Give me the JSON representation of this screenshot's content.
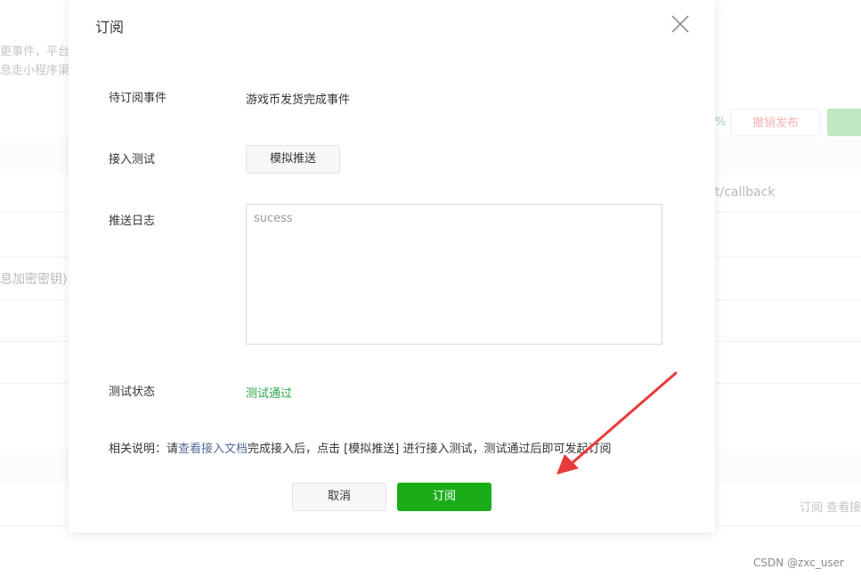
{
  "background": {
    "text_left_1": "更事件，平台",
    "text_left_2": "息走小程序渠",
    "percent": "%",
    "cancel_publish": "撤销发布",
    "callback": "t/callback",
    "secret_hint": "息加密密钥)",
    "row_actions": "订阅 查看接"
  },
  "dialog": {
    "title": "订阅",
    "fields": {
      "event_label": "待订阅事件",
      "event_value": "游戏币发货完成事件",
      "test_label": "接入测试",
      "simulate_button": "模拟推送",
      "log_label": "推送日志",
      "log_value": "sucess",
      "status_label": "测试状态",
      "status_value": "测试通过"
    },
    "note": {
      "prefix": "相关说明：请",
      "link": "查看接入文档",
      "suffix": "完成接入后，点击 [模拟推送] 进行接入测试，测试通过后即可发起订阅"
    },
    "buttons": {
      "cancel": "取消",
      "subscribe": "订阅"
    }
  },
  "watermark": "CSDN @zxc_user",
  "colors": {
    "primary_green": "#1aad19",
    "status_green": "#2aa84a",
    "link_blue": "#576b95",
    "annotation_red": "#e83a3a"
  }
}
